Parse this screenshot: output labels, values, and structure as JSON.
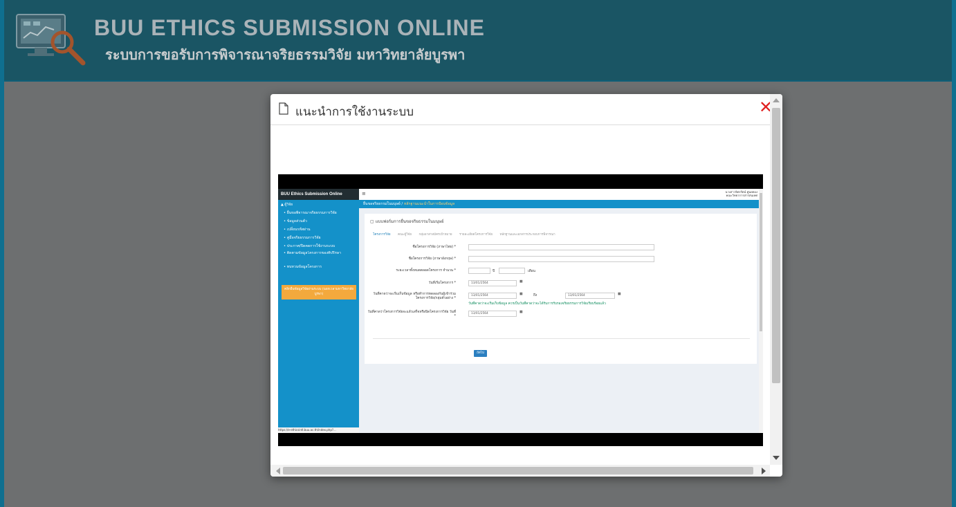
{
  "banner": {
    "title": "BUU ETHICS SUBMISSION ONLINE",
    "subtitle": "ระบบการขอรับการพิจารณาจริยธรรมวิจัย มหาวิทยาลัยบูรพา"
  },
  "modal": {
    "title": "แนะนำการใช้งานระบบ",
    "close_glyph": "✕"
  },
  "embedded": {
    "brand": "BUU Ethics Submission Online",
    "user": "▲ ผู้วิจัย",
    "menu": [
      "• ยื่นขอพิจารณาจริยธรรมการวิจัย",
      "• ข้อมูลส่วนตัว",
      "• เปลี่ยนรหัสผ่าน",
      "• คู่มือจริยธรรมการวิจัย",
      "• ประกาศ/ปิดคดการใช้งานระบบ",
      "• ติดตามข้อมูลโครงการของที่ปรึกษา",
      "• ทบทวนข้อมูลโครงการ"
    ],
    "orange_note": "คลิกยื่นข้อมูลวิจัยผ่านระบบ (นอกเวลามหาวิทยาลัยบูรพา)",
    "account": "นางสาวจิตรรัตน์ ศูนยทอง\nคณะวิทยาการสารสนเทศ",
    "breadcrumb_home": "ยื่นขอจริยธรรมในมนุษย์",
    "breadcrumb_sep": " / ",
    "breadcrumb_current": "หลักฐานแนะนำในการป้อนข้อมูล",
    "panel_title": "แบบฟอร์มการยื่นขอจริยธรรมในมนุษย์",
    "tabs": [
      "โครงการวิจัย",
      "คณะผู้วิจัย",
      "กลุ่มอาสาสมัครเป้าหมาย",
      "รายละเอียดโครงการวิจัย",
      "หลักฐานและเอกสารประกอบการพิจารณา"
    ],
    "fields": [
      {
        "label": "ชื่อโครงการวิจัย (ภาษาไทย) *"
      },
      {
        "label": "ชื่อโครงการวิจัย (ภาษาอังกฤษ) *"
      },
      {
        "label": "ระยะเวลาทั้งหมดตลอดโครงการ จำนวน *",
        "value1": "",
        "sep": "ปี",
        "value2": "",
        "unit": "เดือน"
      },
      {
        "label": "วันที่เริ่มโครงการ *",
        "value": "13/01/2564"
      },
      {
        "label": "วันที่คาดว่าจะเริ่มเก็บข้อมูล หรือทำการทดลองกับผู้เข้าร่วมโครงการวิจัย/กลุ่มตัวอย่าง *",
        "value": "13/01/2564",
        "to": "ถึง",
        "value_end": "13/01/2564"
      },
      {
        "label": "วันที่คาดว่าโครงการวิจัยจะแล้วเสร็จหรือปิดโครงการวิจัย วันที่ *",
        "value": "13/01/2564"
      }
    ],
    "note": "วันที่คาดว่าจะเริ่มเก็บข้อมูล ควรเป็นวันที่คาดว่าจะได้รับการรับรองจริยธรรมการวิจัยเรียบร้อยแล้ว",
    "next_button": "ถัดไป",
    "status_url": "https://e-ethicsintl.buu.ac.th/index.php?...",
    "hamburger": "≡",
    "calendar_glyph": "▦"
  },
  "colors": {
    "banner_bg": "#1a5564",
    "close": "#e02020",
    "sidebar": "#1491c9",
    "orange": "#f3a93d",
    "note_green": "#0a8a5a"
  }
}
